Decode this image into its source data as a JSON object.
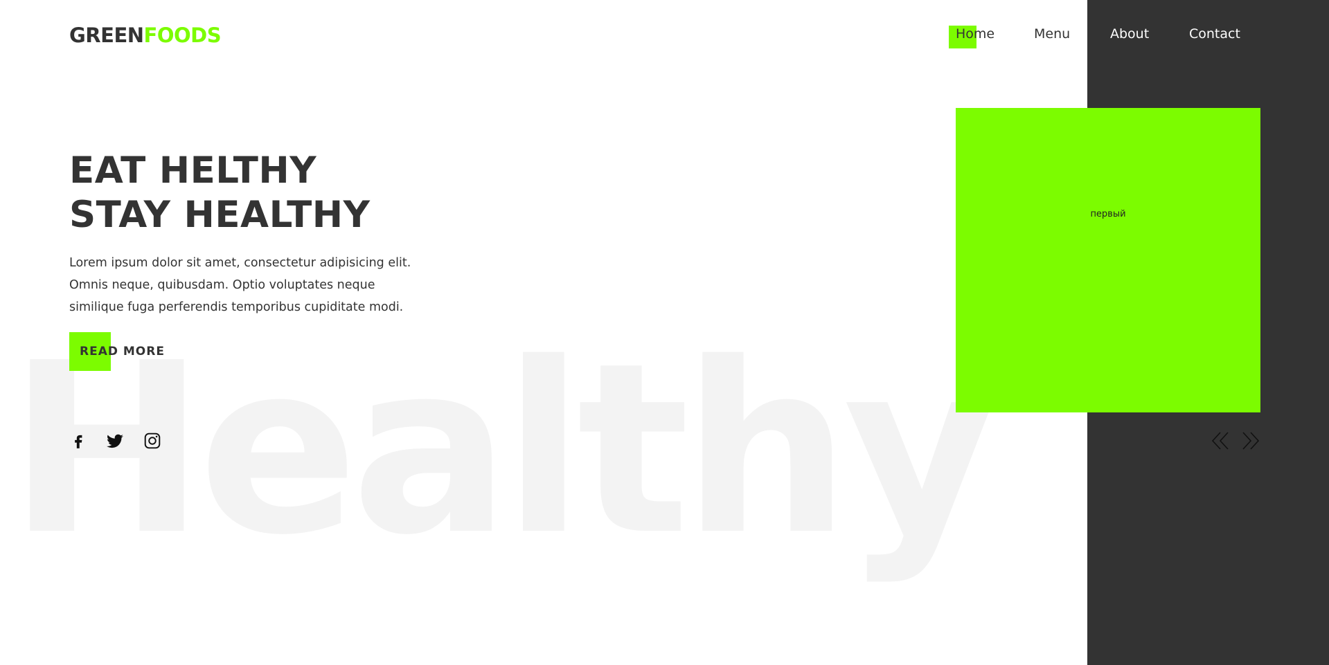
{
  "colors": {
    "accent": "#7cfc00",
    "dark": "#333333",
    "text": "#333333",
    "background_word": "#f3f3f3",
    "panel": "#333333"
  },
  "logo": {
    "part1": "GREEN",
    "part2": "FOODS"
  },
  "nav": {
    "items": [
      {
        "label": "Home",
        "active": true
      },
      {
        "label": "Menu",
        "active": false
      },
      {
        "label": "About",
        "active": false
      },
      {
        "label": "Contact",
        "active": false
      }
    ]
  },
  "hero": {
    "title_line1": "EAT HELTHY",
    "title_line2": "STAY HEALTHY",
    "description": "Lorem ipsum dolor sit amet, consectetur adipisicing elit. Omnis neque, quibusdam. Optio voluptates neque similique fuga perferendis temporibus cupiditate modi.",
    "button_label": "READ MORE",
    "background_word": "Healthy"
  },
  "socials": {
    "icons": [
      "facebook-icon",
      "twitter-icon",
      "instagram-icon"
    ]
  },
  "slider": {
    "caption": "первый",
    "prev_icon": "double-chevron-left-icon",
    "next_icon": "double-chevron-right-icon"
  }
}
